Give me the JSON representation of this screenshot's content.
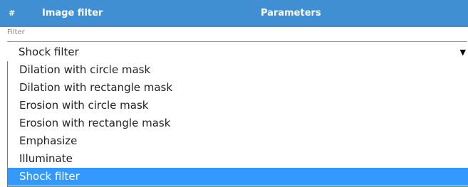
{
  "table_header": {
    "number_col": "#",
    "image_filter_col": "Image filter",
    "parameters_col": "Parameters"
  },
  "filter": {
    "label": "Filter",
    "selected_value": "Shock filter",
    "arrow_icon": "dropdown-arrow",
    "options": [
      "Dilation with circle mask",
      "Dilation with rectangle mask",
      "Erosion with circle mask",
      "Erosion with rectangle mask",
      "Emphasize",
      "Illuminate",
      "Shock filter"
    ],
    "highlighted_index": 6
  },
  "colors": {
    "header_bg": "#3f8fd2",
    "highlight_bg": "#3399ff"
  }
}
